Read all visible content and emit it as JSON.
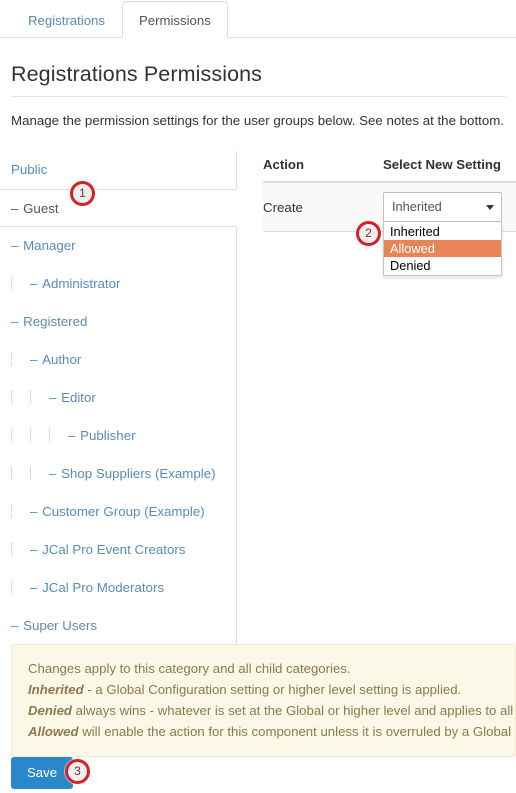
{
  "tabs": [
    {
      "label": "Registrations",
      "active": false
    },
    {
      "label": "Permissions",
      "active": true
    }
  ],
  "page": {
    "title": "Registrations Permissions",
    "lead": "Manage the permission settings for the user groups below. See notes at the bottom."
  },
  "sidebar": {
    "items": [
      {
        "label": "Public",
        "depth": 0,
        "dash": false,
        "active": false
      },
      {
        "label": "Guest",
        "depth": 0,
        "dash": true,
        "active": true
      },
      {
        "label": "Manager",
        "depth": 0,
        "dash": true,
        "active": false
      },
      {
        "label": "Administrator",
        "depth": 1,
        "dash": true,
        "active": false
      },
      {
        "label": "Registered",
        "depth": 0,
        "dash": true,
        "active": false
      },
      {
        "label": "Author",
        "depth": 1,
        "dash": true,
        "active": false
      },
      {
        "label": "Editor",
        "depth": 2,
        "dash": true,
        "active": false
      },
      {
        "label": "Publisher",
        "depth": 3,
        "dash": true,
        "active": false
      },
      {
        "label": "Shop Suppliers (Example)",
        "depth": 2,
        "dash": true,
        "active": false
      },
      {
        "label": "Customer Group (Example)",
        "depth": 1,
        "dash": true,
        "active": false
      },
      {
        "label": "JCal Pro Event Creators",
        "depth": 1,
        "dash": true,
        "active": false
      },
      {
        "label": "JCal Pro Moderators",
        "depth": 1,
        "dash": true,
        "active": false
      },
      {
        "label": "Super Users",
        "depth": 0,
        "dash": true,
        "active": false
      }
    ]
  },
  "permissions_table": {
    "headers": {
      "action": "Action",
      "setting": "Select New Setting"
    },
    "rows": [
      {
        "action": "Create"
      }
    ]
  },
  "setting_select": {
    "value": "Inherited",
    "expanded": true,
    "options": [
      {
        "label": "Inherited",
        "selected": false
      },
      {
        "label": "Allowed",
        "selected": true
      },
      {
        "label": "Denied",
        "selected": false
      }
    ],
    "caret_icon": "chevron-down-icon",
    "highlight_color": "#e98456",
    "border_color": "#d8b9a5"
  },
  "notes": {
    "line1": "Changes apply to this category and all child categories.",
    "line2_term": "Inherited",
    "line2_text": " - a Global Configuration setting or higher level setting is applied.",
    "line3_term": "Denied",
    "line3_text": " always wins - whatever is set at the Global or higher level and applies to all ch",
    "line4_term": "Allowed",
    "line4_text": " will enable the action for this component unless it is overruled by a Global Co",
    "background_color": "#fcf8e8"
  },
  "footer": {
    "save_label": "Save",
    "save_color": "#2a87ca"
  },
  "callouts": [
    {
      "number": "1",
      "target": "guest-group-item"
    },
    {
      "number": "2",
      "target": "allowed-option"
    },
    {
      "number": "3",
      "target": "save-button"
    }
  ]
}
